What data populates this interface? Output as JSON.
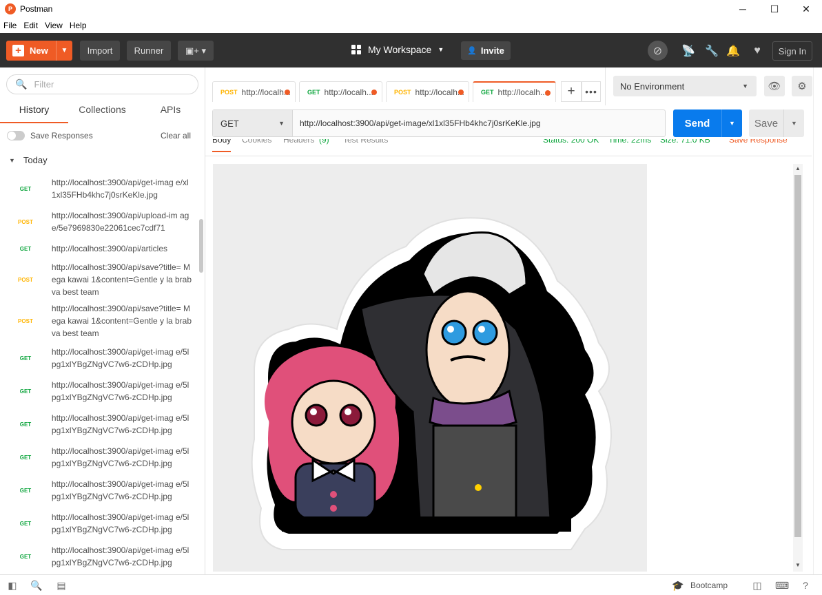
{
  "app": {
    "title": "Postman",
    "logo_letter": "P"
  },
  "window": {
    "minimize": "─",
    "maximize": "☐",
    "close": "✕"
  },
  "menubar": [
    "File",
    "Edit",
    "View",
    "Help"
  ],
  "header": {
    "new_label": "New",
    "import_label": "Import",
    "runner_label": "Runner",
    "workspace_label": "My Workspace",
    "invite_label": "Invite",
    "signin_label": "Sign In"
  },
  "sidebar": {
    "filter_placeholder": "Filter",
    "tabs": [
      "History",
      "Collections",
      "APIs"
    ],
    "save_responses_label": "Save Responses",
    "clear_all_label": "Clear all",
    "group_label": "Today",
    "history": [
      {
        "method": "GET",
        "url": "http://localhost:3900/api/get-imag e/xl1xl35FHb4khc7j0srKeKle.jpg"
      },
      {
        "method": "POST",
        "url": "http://localhost:3900/api/upload-im age/5e7969830e22061cec7cdf71"
      },
      {
        "method": "GET",
        "url": "http://localhost:3900/api/articles"
      },
      {
        "method": "POST",
        "url": "http://localhost:3900/api/save?title= Mega kawai 1&content=Gentle y la brabva best team"
      },
      {
        "method": "POST",
        "url": "http://localhost:3900/api/save?title= Mega kawai 1&content=Gentle y la brabva best team"
      },
      {
        "method": "GET",
        "url": "http://localhost:3900/api/get-imag e/5lpg1xlYBgZNgVC7w6-zCDHp.jpg"
      },
      {
        "method": "GET",
        "url": "http://localhost:3900/api/get-imag e/5lpg1xlYBgZNgVC7w6-zCDHp.jpg"
      },
      {
        "method": "GET",
        "url": "http://localhost:3900/api/get-imag e/5lpg1xlYBgZNgVC7w6-zCDHp.jpg"
      },
      {
        "method": "GET",
        "url": "http://localhost:3900/api/get-imag e/5lpg1xlYBgZNgVC7w6-zCDHp.jpg"
      },
      {
        "method": "GET",
        "url": "http://localhost:3900/api/get-imag e/5lpg1xlYBgZNgVC7w6-zCDHp.jpg"
      },
      {
        "method": "GET",
        "url": "http://localhost:3900/api/get-imag e/5lpg1xlYBgZNgVC7w6-zCDHp.jpg"
      },
      {
        "method": "GET",
        "url": "http://localhost:3900/api/get-imag e/5lpg1xlYBgZNgVC7w6-zCDHp.jpg"
      }
    ]
  },
  "request_tabs": [
    {
      "method": "POST",
      "url": "http://localh..."
    },
    {
      "method": "GET",
      "url": "http://localh..."
    },
    {
      "method": "POST",
      "url": "http://localh..."
    },
    {
      "method": "GET",
      "url": "http://localh..."
    }
  ],
  "environment": {
    "selected": "No Environment"
  },
  "request": {
    "method": "GET",
    "url": "http://localhost:3900/api/get-image/xl1xl35FHb4khc7j0srKeKle.jpg",
    "send_label": "Send",
    "save_label": "Save"
  },
  "response": {
    "tabs": [
      "Body",
      "Cookies",
      "Headers",
      "(9)",
      "Test Results"
    ],
    "status": "Status: 200 OK",
    "time": "Time: 22ms",
    "size": "Size: 71.0 KB",
    "save_response": "Save Response"
  },
  "statusbar": {
    "bootcamp_label": "Bootcamp"
  },
  "colors": {
    "brand": "#ef5b25",
    "send": "#097bed",
    "get": "#0ca53c",
    "post": "#ffb400",
    "header_bg": "#303030"
  }
}
